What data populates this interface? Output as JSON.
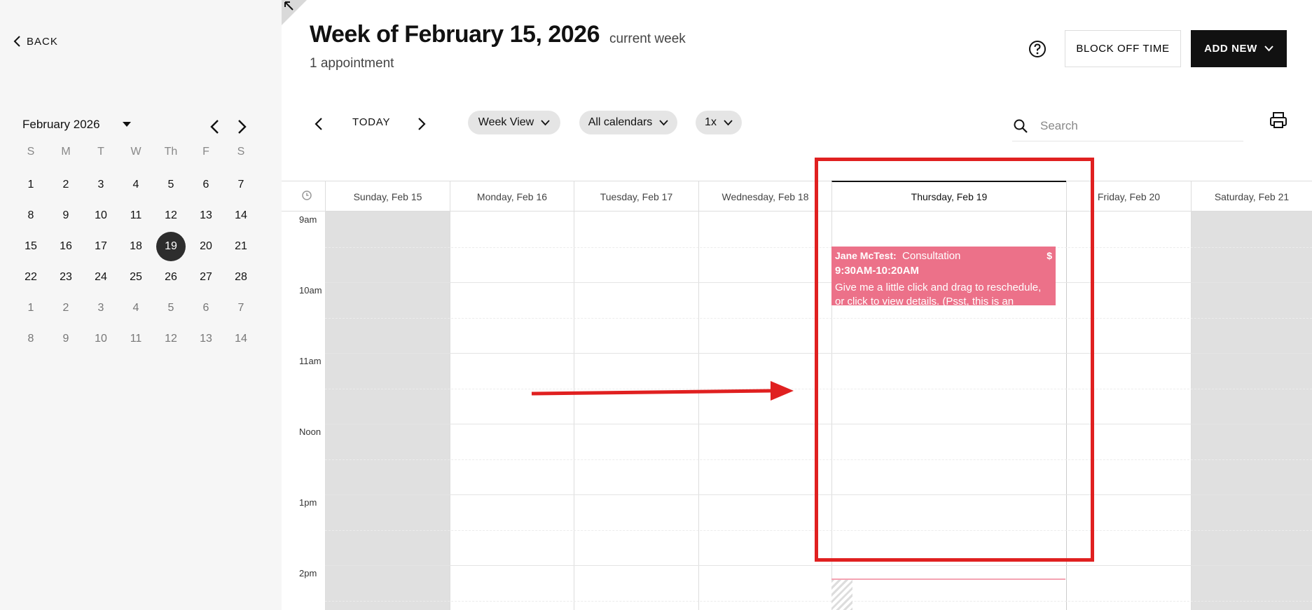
{
  "sidebar": {
    "back_label": "BACK",
    "month_label": "February 2026",
    "weekday_headers": [
      "S",
      "M",
      "T",
      "W",
      "Th",
      "F",
      "S"
    ],
    "weeks": [
      [
        "1",
        "2",
        "3",
        "4",
        "5",
        "6",
        "7"
      ],
      [
        "8",
        "9",
        "10",
        "11",
        "12",
        "13",
        "14"
      ],
      [
        "15",
        "16",
        "17",
        "18",
        "19",
        "20",
        "21"
      ],
      [
        "22",
        "23",
        "24",
        "25",
        "26",
        "27",
        "28"
      ],
      [
        "1",
        "2",
        "3",
        "4",
        "5",
        "6",
        "7"
      ],
      [
        "8",
        "9",
        "10",
        "11",
        "12",
        "13",
        "14"
      ]
    ],
    "selected_day": "19"
  },
  "header": {
    "title": "Week of February 15, 2026",
    "current_week_label": "current week",
    "appointment_count": "1 appointment",
    "block_off_label": "BLOCK OFF TIME",
    "add_new_label": "ADD NEW"
  },
  "toolbar": {
    "today_label": "TODAY",
    "view_label": "Week View",
    "calendars_label": "All calendars",
    "zoom_label": "1x",
    "search_placeholder": "Search"
  },
  "calendar": {
    "days": [
      {
        "label": "Sunday, Feb 15"
      },
      {
        "label": "Monday, Feb 16"
      },
      {
        "label": "Tuesday, Feb 17"
      },
      {
        "label": "Wednesday, Feb 18"
      },
      {
        "label": "Thursday, Feb 19"
      },
      {
        "label": "Friday, Feb 20"
      },
      {
        "label": "Saturday, Feb 21"
      }
    ],
    "hours": [
      "9am",
      "10am",
      "11am",
      "Noon",
      "1pm",
      "2pm"
    ],
    "appointment": {
      "client": "Jane McTest:",
      "type": "Consultation",
      "price_icon": "$",
      "time": "9:30AM-10:20AM",
      "note": "Give me a little click and drag to reschedule, or click to view details. (Psst, this is an"
    }
  },
  "colors": {
    "appointment": "#ec7189",
    "annotation": "#e02020",
    "selected_day": "#2d2d2d"
  }
}
